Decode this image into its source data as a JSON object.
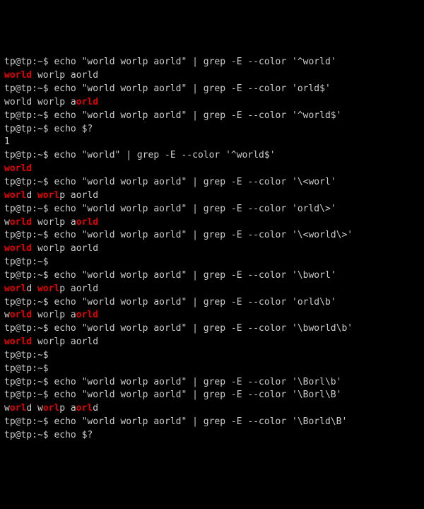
{
  "prompt": "tp@tp:~$ ",
  "lines": [
    {
      "type": "cmd",
      "text": "echo \"world worlp aorld\" | grep -E --color '^world'"
    },
    {
      "type": "out",
      "segments": [
        {
          "t": "world",
          "hl": true
        },
        {
          "t": " worlp aorld",
          "hl": false
        }
      ]
    },
    {
      "type": "cmd",
      "text": "echo \"world worlp aorld\" | grep -E --color 'orld$'"
    },
    {
      "type": "out",
      "segments": [
        {
          "t": "world worlp a",
          "hl": false
        },
        {
          "t": "orld",
          "hl": true
        }
      ]
    },
    {
      "type": "cmd",
      "text": "echo \"world worlp aorld\" | grep -E --color '^world$'"
    },
    {
      "type": "cmd",
      "text": "echo $?"
    },
    {
      "type": "out",
      "segments": [
        {
          "t": "1",
          "hl": false
        }
      ]
    },
    {
      "type": "cmd",
      "text": "echo \"world\" | grep -E --color '^world$'"
    },
    {
      "type": "out",
      "segments": [
        {
          "t": "world",
          "hl": true
        }
      ]
    },
    {
      "type": "cmd",
      "text": "echo \"world worlp aorld\" | grep -E --color '\\<worl'"
    },
    {
      "type": "out",
      "segments": [
        {
          "t": "worl",
          "hl": true
        },
        {
          "t": "d ",
          "hl": false
        },
        {
          "t": "worl",
          "hl": true
        },
        {
          "t": "p aorld",
          "hl": false
        }
      ]
    },
    {
      "type": "cmd",
      "text": "echo \"world worlp aorld\" | grep -E --color 'orld\\>'"
    },
    {
      "type": "out",
      "segments": [
        {
          "t": "w",
          "hl": false
        },
        {
          "t": "orld",
          "hl": true
        },
        {
          "t": " worlp a",
          "hl": false
        },
        {
          "t": "orld",
          "hl": true
        }
      ]
    },
    {
      "type": "cmd",
      "text": "echo \"world worlp aorld\" | grep -E --color '\\<world\\>'"
    },
    {
      "type": "out",
      "segments": [
        {
          "t": "world",
          "hl": true
        },
        {
          "t": " worlp aorld",
          "hl": false
        }
      ]
    },
    {
      "type": "cmd",
      "text": ""
    },
    {
      "type": "cmd",
      "text": "echo \"world worlp aorld\" | grep -E --color '\\bworl'"
    },
    {
      "type": "out",
      "segments": [
        {
          "t": "worl",
          "hl": true
        },
        {
          "t": "d ",
          "hl": false
        },
        {
          "t": "worl",
          "hl": true
        },
        {
          "t": "p aorld",
          "hl": false
        }
      ]
    },
    {
      "type": "cmd",
      "text": "echo \"world worlp aorld\" | grep -E --color 'orld\\b'"
    },
    {
      "type": "out",
      "segments": [
        {
          "t": "w",
          "hl": false
        },
        {
          "t": "orld",
          "hl": true
        },
        {
          "t": " worlp a",
          "hl": false
        },
        {
          "t": "orld",
          "hl": true
        }
      ]
    },
    {
      "type": "cmd",
      "text": "echo \"world worlp aorld\" | grep -E --color '\\bworld\\b'"
    },
    {
      "type": "out",
      "segments": [
        {
          "t": "world",
          "hl": true
        },
        {
          "t": " worlp aorld",
          "hl": false
        }
      ]
    },
    {
      "type": "cmd",
      "text": ""
    },
    {
      "type": "cmd",
      "text": ""
    },
    {
      "type": "cmd",
      "text": "echo \"world worlp aorld\" | grep -E --color '\\Borl\\b'"
    },
    {
      "type": "cmd",
      "text": "echo \"world worlp aorld\" | grep -E --color '\\Borl\\B'"
    },
    {
      "type": "out",
      "segments": [
        {
          "t": "w",
          "hl": false
        },
        {
          "t": "orl",
          "hl": true
        },
        {
          "t": "d w",
          "hl": false
        },
        {
          "t": "orl",
          "hl": true
        },
        {
          "t": "p a",
          "hl": false
        },
        {
          "t": "orl",
          "hl": true
        },
        {
          "t": "d",
          "hl": false
        }
      ]
    },
    {
      "type": "cmd",
      "text": "echo \"world worlp aorld\" | grep -E --color '\\Borld\\B'"
    },
    {
      "type": "cmd",
      "text": "echo $?"
    }
  ]
}
